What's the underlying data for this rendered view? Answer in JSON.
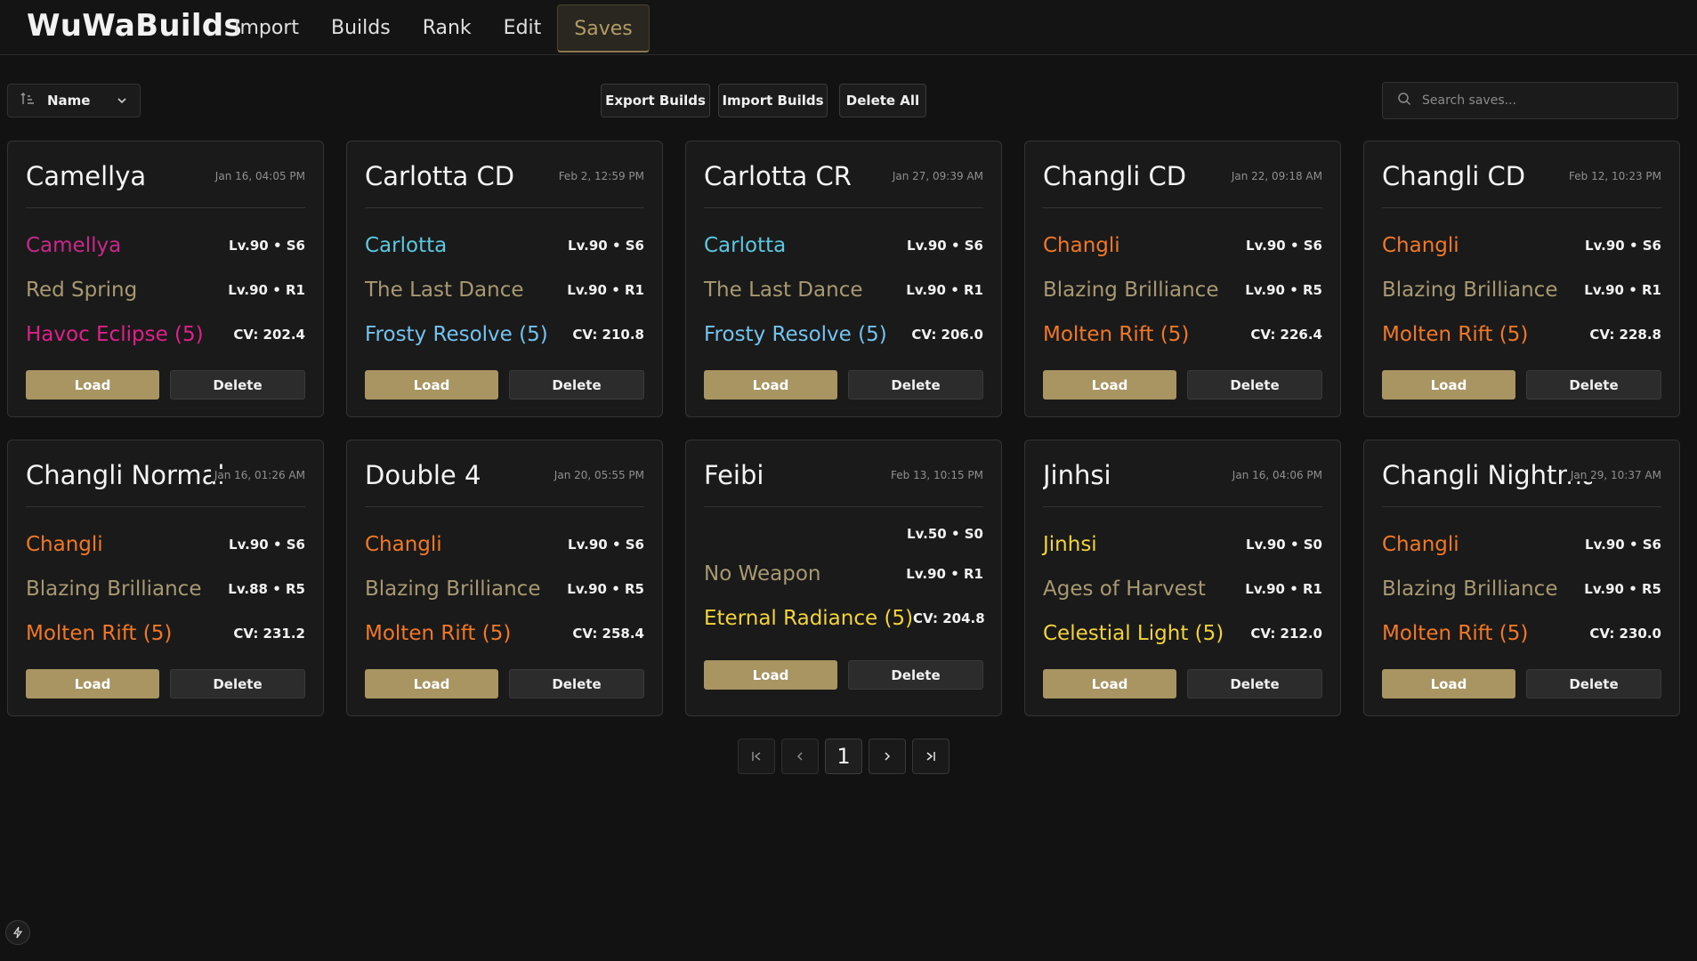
{
  "app": {
    "brand": "WuWaBuilds",
    "nav": [
      {
        "label": "Import"
      },
      {
        "label": "Builds"
      },
      {
        "label": "Rank"
      },
      {
        "label": "Edit"
      },
      {
        "label": "Saves",
        "active": true
      }
    ]
  },
  "toolbar": {
    "sort_label": "Name",
    "export_label": "Export Builds",
    "import_label": "Import Builds",
    "delete_all_label": "Delete All",
    "search_placeholder": "Search saves..."
  },
  "colors": {
    "accent": "#a89561",
    "havoc": "#e0208a",
    "glacio": "#5cc8e0",
    "fusion": "#f07826",
    "spectro": "#f2d43a",
    "weapon": "#a89973"
  },
  "cards": [
    {
      "title": "Camellya",
      "date": "Jan 16, 04:05 PM",
      "character": "Camellya",
      "char_level": "Lv.90 • S6",
      "weapon": "Red Spring",
      "weapon_level": "Lv.90 • R1",
      "echo_set": "Havoc Eclipse (5)",
      "cv": "CV: 202.4",
      "element_color": "#e0208a",
      "load": "Load",
      "delete": "Delete"
    },
    {
      "title": "Carlotta CD",
      "date": "Feb 2, 12:59 PM",
      "character": "Carlotta",
      "char_level": "Lv.90 • S6",
      "weapon": "The Last Dance",
      "weapon_level": "Lv.90 • R1",
      "echo_set": "Frosty Resolve (5)",
      "cv": "CV: 210.8",
      "element_color": "#5cc8e0",
      "load": "Load",
      "delete": "Delete"
    },
    {
      "title": "Carlotta CR",
      "date": "Jan 27, 09:39 AM",
      "character": "Carlotta",
      "char_level": "Lv.90 • S6",
      "weapon": "The Last Dance",
      "weapon_level": "Lv.90 • R1",
      "echo_set": "Frosty Resolve (5)",
      "cv": "CV: 206.0",
      "element_color": "#5cc8e0",
      "load": "Load",
      "delete": "Delete"
    },
    {
      "title": "Changli CD",
      "date": "Jan 22, 09:18 AM",
      "character": "Changli",
      "char_level": "Lv.90 • S6",
      "weapon": "Blazing Brilliance",
      "weapon_level": "Lv.90 • R5",
      "echo_set": "Molten Rift (5)",
      "cv": "CV: 226.4",
      "element_color": "#f07826",
      "load": "Load",
      "delete": "Delete"
    },
    {
      "title": "Changli CD",
      "date": "Feb 12, 10:23 PM",
      "character": "Changli",
      "char_level": "Lv.90 • S6",
      "weapon": "Blazing Brilliance",
      "weapon_level": "Lv.90 • R1",
      "echo_set": "Molten Rift (5)",
      "cv": "CV: 228.8",
      "element_color": "#f07826",
      "load": "Load",
      "delete": "Delete"
    },
    {
      "title": "Changli Normal",
      "date": "Jan 16, 01:26 AM",
      "character": "Changli",
      "char_level": "Lv.90 • S6",
      "weapon": "Blazing Brilliance",
      "weapon_level": "Lv.88 • R5",
      "echo_set": "Molten Rift (5)",
      "cv": "CV: 231.2",
      "element_color": "#f07826",
      "load": "Load",
      "delete": "Delete"
    },
    {
      "title": "Double 4",
      "date": "Jan 20, 05:55 PM",
      "character": "Changli",
      "char_level": "Lv.90 • S6",
      "weapon": "Blazing Brilliance",
      "weapon_level": "Lv.90 • R5",
      "echo_set": "Molten Rift (5)",
      "cv": "CV: 258.4",
      "element_color": "#f07826",
      "load": "Load",
      "delete": "Delete"
    },
    {
      "title": "Feibi",
      "date": "Feb 13, 10:15 PM",
      "character": "",
      "char_level": "Lv.50 • S0",
      "weapon": "No Weapon",
      "weapon_level": "Lv.90 • R1",
      "echo_set": "Eternal Radiance (5)",
      "cv": "CV: 204.8",
      "element_color": "#f2d43a",
      "load": "Load",
      "delete": "Delete"
    },
    {
      "title": "Jinhsi",
      "date": "Jan 16, 04:06 PM",
      "character": "Jinhsi",
      "char_level": "Lv.90 • S0",
      "weapon": "Ages of Harvest",
      "weapon_level": "Lv.90 • R1",
      "echo_set": "Celestial Light (5)",
      "cv": "CV: 212.0",
      "element_color": "#f2d43a",
      "load": "Load",
      "delete": "Delete"
    },
    {
      "title": "Changli Nightmare",
      "date": "Jan 29, 10:37 AM",
      "character": "Changli",
      "char_level": "Lv.90 • S6",
      "weapon": "Blazing Brilliance",
      "weapon_level": "Lv.90 • R5",
      "echo_set": "Molten Rift (5)",
      "cv": "CV: 230.0",
      "element_color": "#f07826",
      "load": "Load",
      "delete": "Delete"
    }
  ],
  "pagination": {
    "current_page": "1",
    "first_icon": "first-page-icon",
    "prev_icon": "chevron-left-icon",
    "next_icon": "chevron-right-icon",
    "last_icon": "last-page-icon"
  }
}
